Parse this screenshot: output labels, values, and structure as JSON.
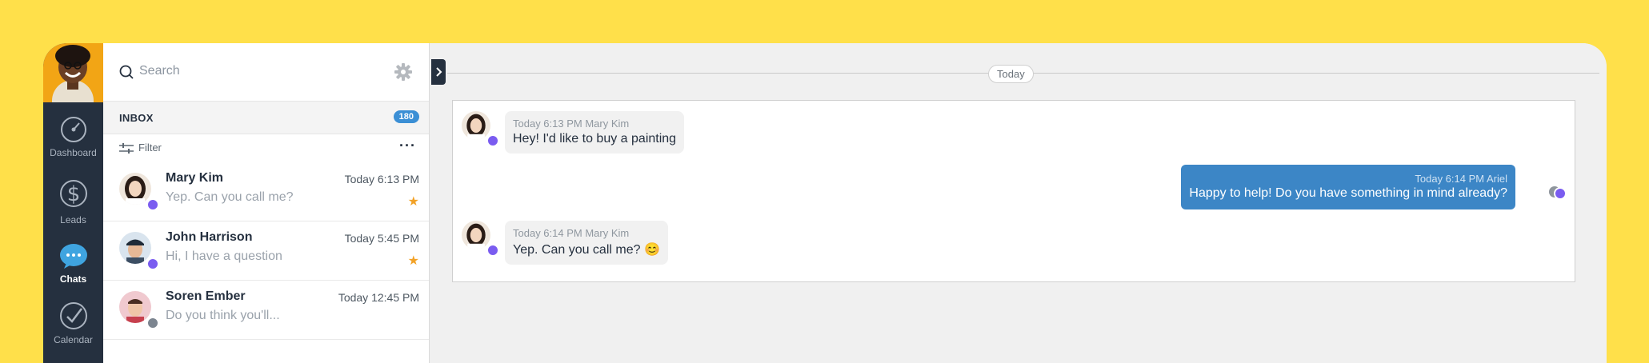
{
  "nav": {
    "items": [
      {
        "label": "Dashboard",
        "icon": "dashboard-icon"
      },
      {
        "label": "Leads",
        "icon": "dollar-icon"
      },
      {
        "label": "Chats",
        "icon": "chat-bubble-icon"
      },
      {
        "label": "Calendar",
        "icon": "checkmark-icon"
      }
    ]
  },
  "search": {
    "placeholder": "Search"
  },
  "inbox": {
    "label": "INBOX",
    "count": "180"
  },
  "filter": {
    "label": "Filter",
    "more": "···"
  },
  "chats": [
    {
      "name": "Mary Kim",
      "preview": "Yep. Can you call me?",
      "time": "Today 6:13 PM",
      "starred": true
    },
    {
      "name": "John Harrison",
      "preview": "Hi, I have a question",
      "time": "Today 5:45 PM",
      "starred": true
    },
    {
      "name": "Soren Ember",
      "preview": "Do you think you'll...",
      "time": "Today 12:45 PM",
      "starred": false
    }
  ],
  "conversation": {
    "date_divider": "Today",
    "messages": [
      {
        "direction": "in",
        "meta": "Today 6:13 PM Mary Kim",
        "text": "Hey! I'd like to buy a painting"
      },
      {
        "direction": "out",
        "meta": "Today 6:14 PM Ariel",
        "text": "Happy to help! Do you have something in mind already?"
      },
      {
        "direction": "in",
        "meta": "Today 6:14 PM Mary Kim",
        "text": "Yep. Can you call me? 😊"
      }
    ]
  },
  "colors": {
    "background": "#FFE04A",
    "nav": "#25303F",
    "accent": "#3B8FD5",
    "outgoing_bubble": "#3C86C6",
    "star": "#F2A227",
    "messenger": "#7A5CF0"
  }
}
